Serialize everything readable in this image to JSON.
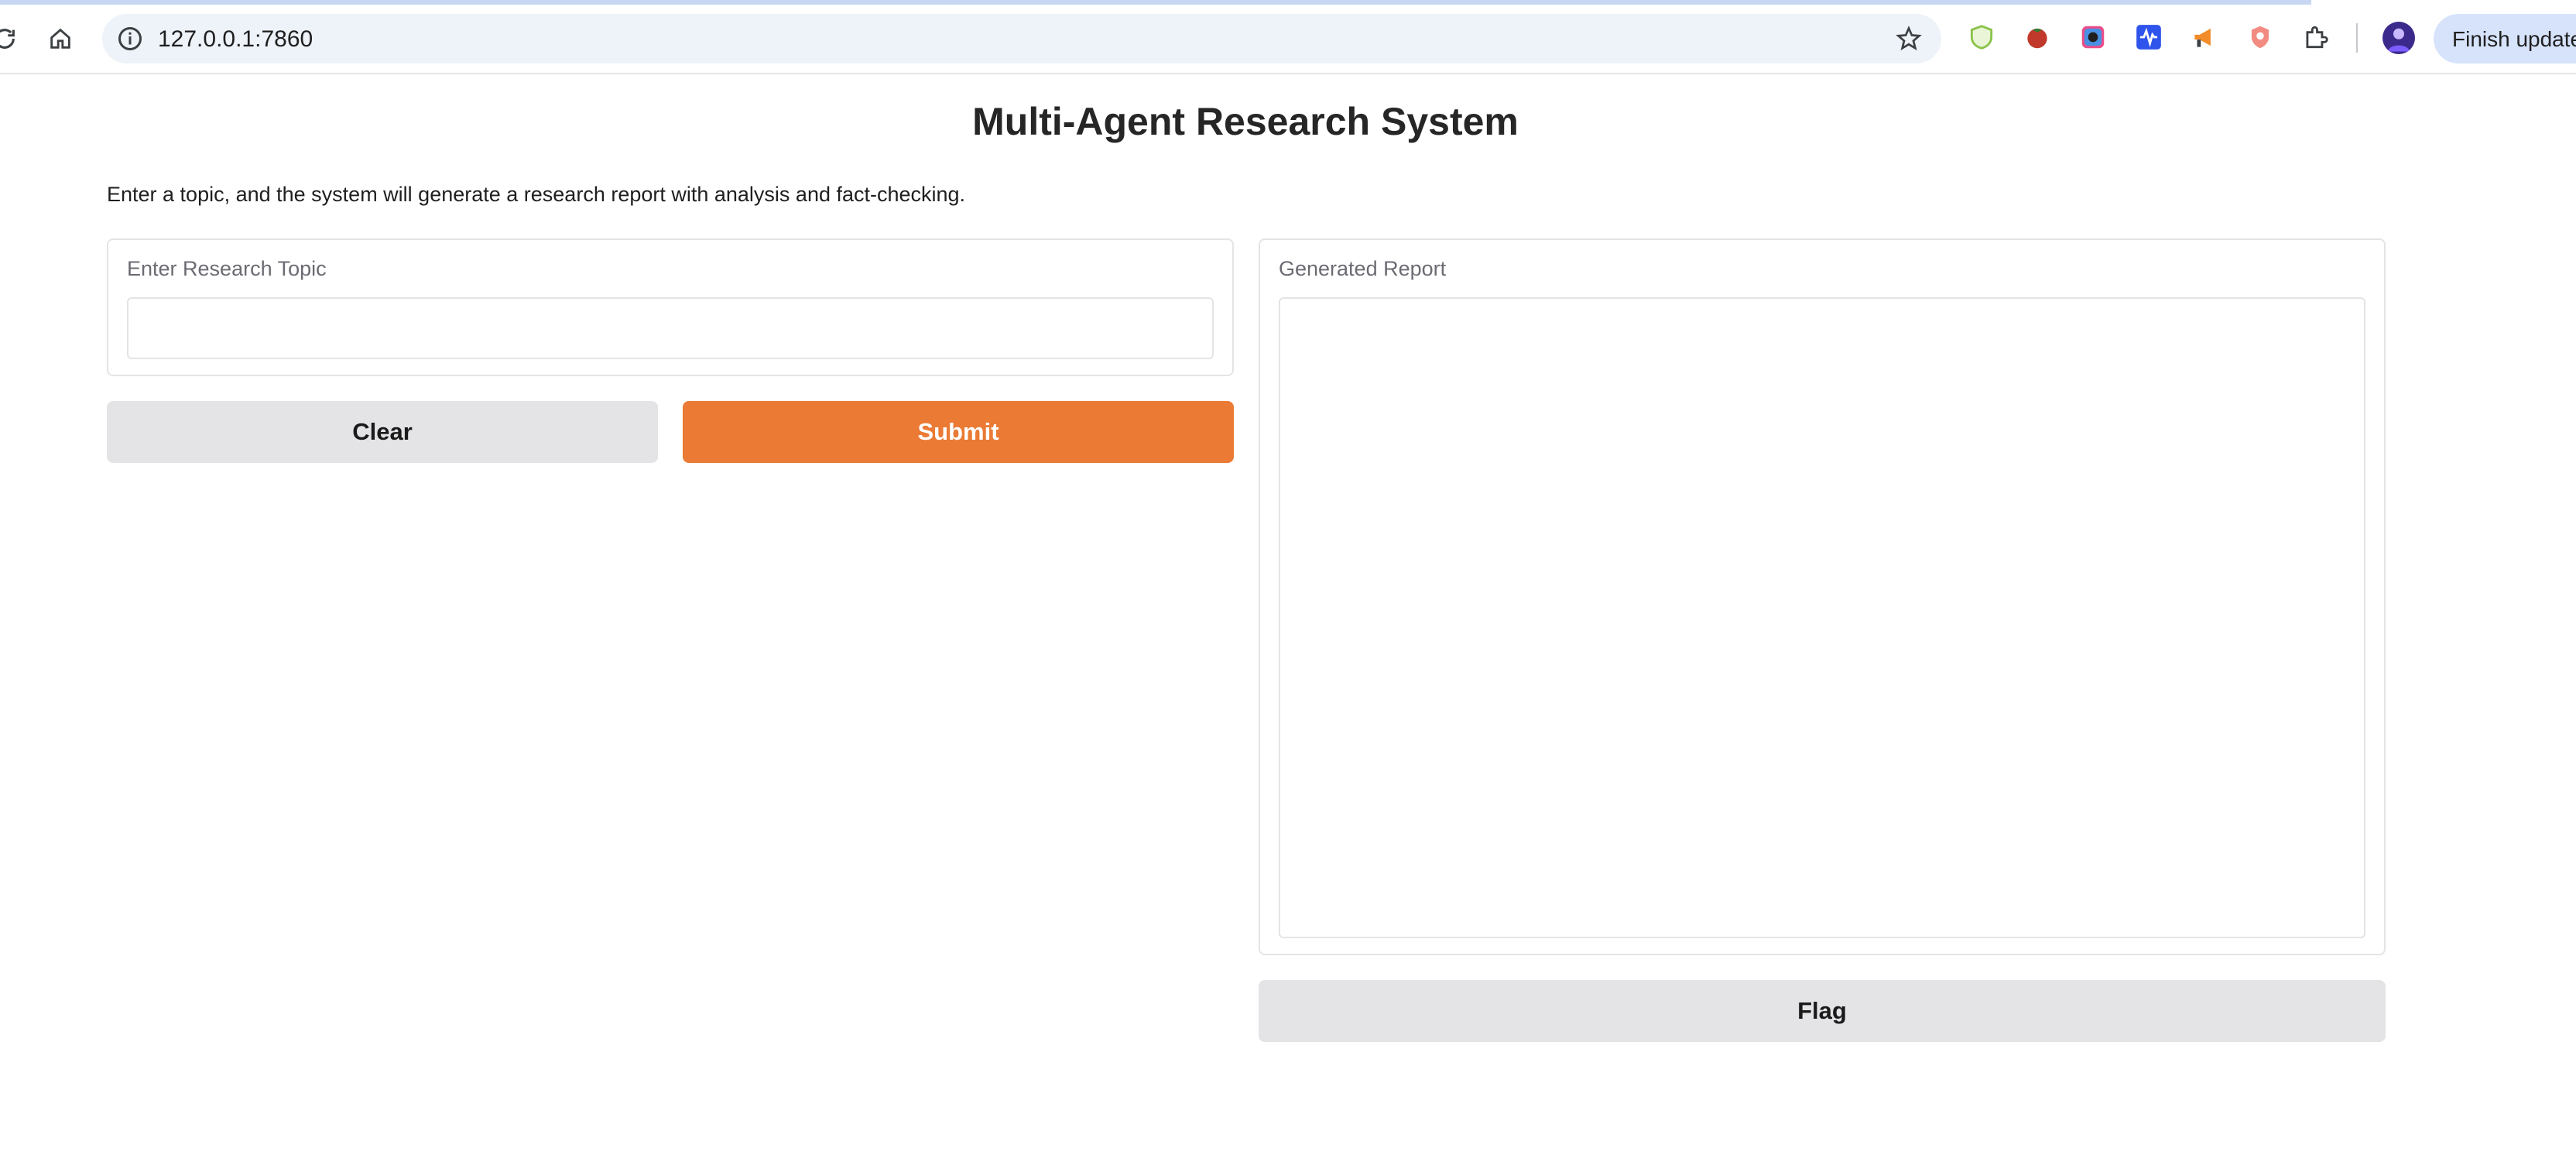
{
  "browser": {
    "url": "127.0.0.1:7860",
    "finish_update_label": "Finish update",
    "icons": [
      "reload-icon",
      "home-icon",
      "site-info-icon",
      "bookmark-star-icon",
      "shield-extension-icon",
      "tomato-extension-icon",
      "color-extension-icon",
      "waveform-extension-icon",
      "megaphone-extension-icon",
      "brave-extension-icon",
      "puzzle-extensions-icon",
      "profile-avatar"
    ]
  },
  "page": {
    "title": "Multi-Agent Research System",
    "description": "Enter a topic, and the system will generate a research report with analysis and fact-checking."
  },
  "input_panel": {
    "label": "Enter Research Topic",
    "value": "",
    "placeholder": ""
  },
  "buttons": {
    "clear_label": "Clear",
    "submit_label": "Submit",
    "flag_label": "Flag"
  },
  "output_panel": {
    "label": "Generated Report",
    "value": ""
  },
  "colors": {
    "primary": "#ea7a34",
    "secondary": "#e4e4e7",
    "border": "#e4e4e7"
  }
}
